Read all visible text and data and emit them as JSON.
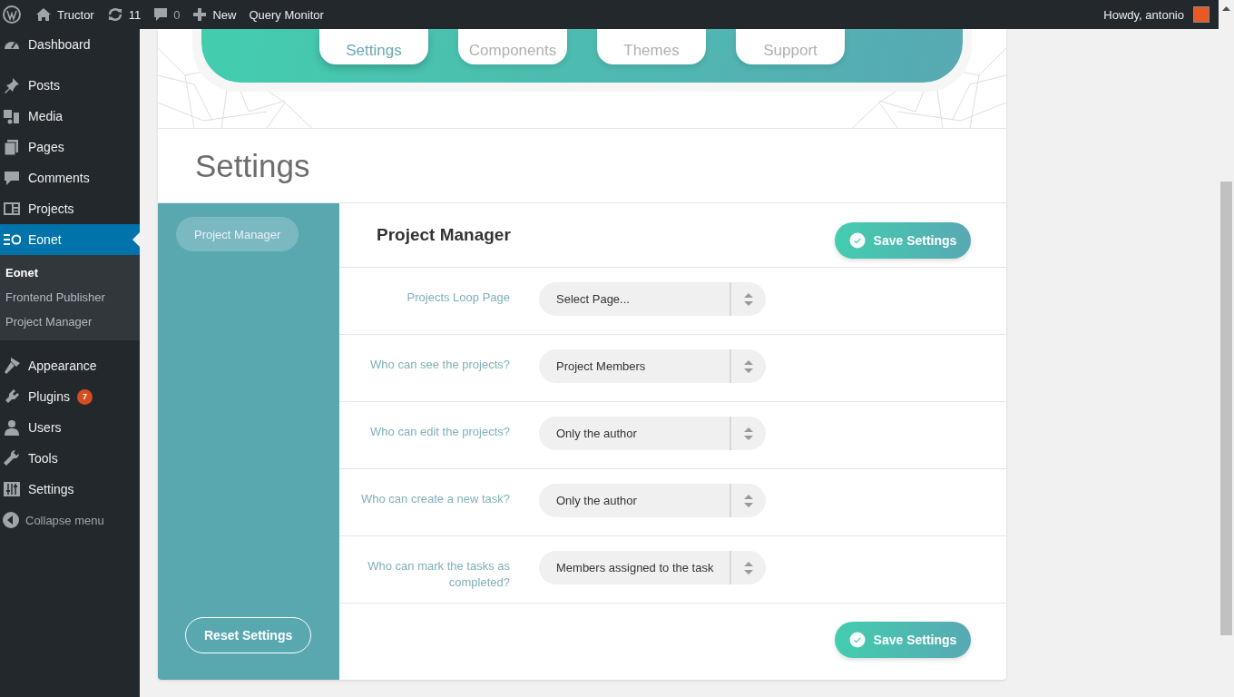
{
  "admin_bar": {
    "site": "Tructor",
    "updates": "11",
    "comments": "0",
    "new": "New",
    "query_monitor": "Query Monitor",
    "greeting": "Howdy, antonio"
  },
  "sidebar": {
    "items": [
      {
        "label": "Dashboard",
        "kind": "dashboard",
        "selected": false
      },
      {
        "label": "Posts",
        "kind": "posts",
        "selected": false
      },
      {
        "label": "Media",
        "kind": "media",
        "selected": false
      },
      {
        "label": "Pages",
        "kind": "pages",
        "selected": false
      },
      {
        "label": "Comments",
        "kind": "comments",
        "selected": false
      },
      {
        "label": "Projects",
        "kind": "projects",
        "selected": false
      },
      {
        "label": "Eonet",
        "kind": "eonet",
        "selected": true,
        "children": [
          {
            "label": "Eonet",
            "selected": true
          },
          {
            "label": "Frontend Publisher",
            "selected": false
          },
          {
            "label": "Project Manager",
            "selected": false
          }
        ]
      },
      {
        "label": "Appearance",
        "kind": "appearance",
        "selected": false
      },
      {
        "label": "Plugins",
        "kind": "plugins",
        "selected": false,
        "badge": "7"
      },
      {
        "label": "Users",
        "kind": "users",
        "selected": false
      },
      {
        "label": "Tools",
        "kind": "tools",
        "selected": false
      },
      {
        "label": "Settings",
        "kind": "settings",
        "selected": false
      }
    ],
    "collapse": "Collapse menu"
  },
  "tabs": [
    {
      "label": "Settings",
      "selected": true
    },
    {
      "label": "Components",
      "selected": false
    },
    {
      "label": "Themes",
      "selected": false
    },
    {
      "label": "Support",
      "selected": false
    }
  ],
  "page_title": "Settings",
  "nav": [
    {
      "label": "Project Manager",
      "selected": true
    }
  ],
  "section_title": "Project Manager",
  "save_buttons": [
    "Save Settings",
    "Save Settings"
  ],
  "fields": [
    {
      "label": "Projects Loop Page",
      "value": "Select Page..."
    },
    {
      "label": "Who can see the projects?",
      "value": "Project Members"
    },
    {
      "label": "Who can edit the projects?",
      "value": "Only the author"
    },
    {
      "label": "Who can create a new task?",
      "value": "Only the author"
    },
    {
      "label": "Who can mark the tasks as completed?",
      "value": "Members assigned to the task"
    }
  ],
  "reset_button": "Reset Settings"
}
